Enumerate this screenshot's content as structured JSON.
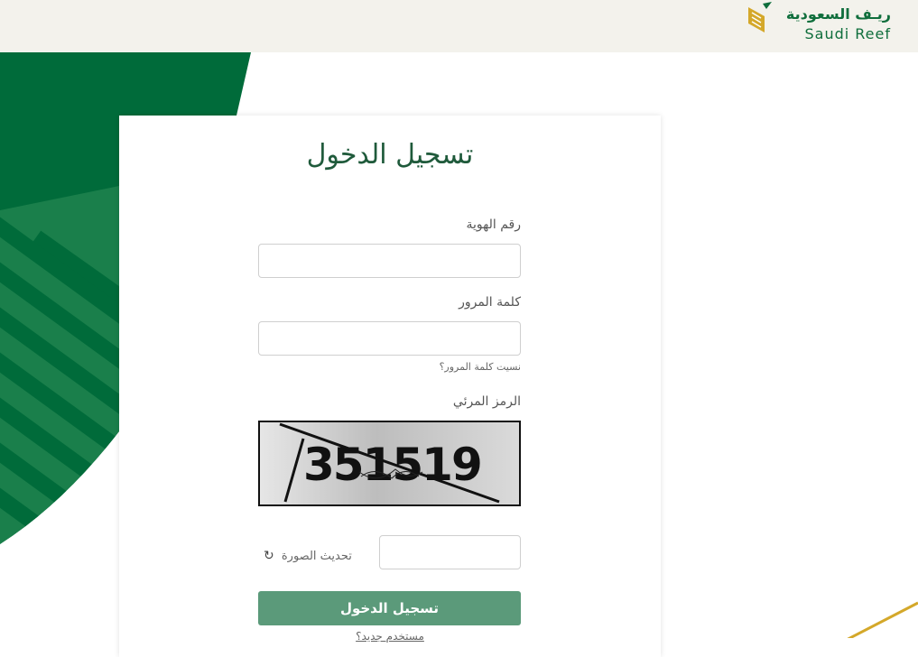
{
  "header": {
    "logo_ar": "ريـف السعودية",
    "logo_en": "Saudi Reef"
  },
  "login": {
    "title": "تسجيل الدخول",
    "id_label": "رقم الهوية",
    "id_value": "",
    "password_label": "كلمة المرور",
    "password_value": "",
    "forgot_link": "نسيت كلمة المرور؟",
    "captcha_label": "الرمز المرئي",
    "captcha_text": "351519",
    "captcha_value": "",
    "refresh_label": "تحديث الصورة",
    "submit_label": "تسجيل الدخول",
    "new_user_link": "مستخدم جديد؟"
  },
  "colors": {
    "brand_green": "#0f6e3c",
    "button_green": "#5b9a7a",
    "gold": "#d4a82a"
  },
  "icons": {
    "refresh": "refresh-icon"
  }
}
